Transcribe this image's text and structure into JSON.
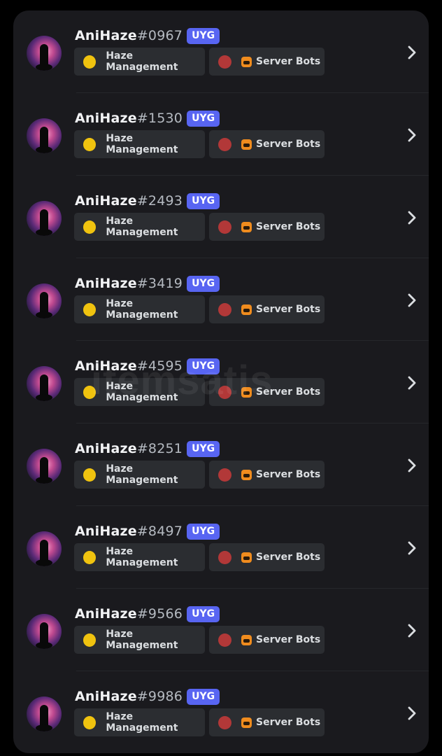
{
  "rows": [
    {
      "username": "AniHaze",
      "discriminator": "#0967",
      "badge": "UYG",
      "role1": "Haze Management",
      "role2": "Server Bots"
    },
    {
      "username": "AniHaze",
      "discriminator": "#1530",
      "badge": "UYG",
      "role1": "Haze Management",
      "role2": "Server Bots"
    },
    {
      "username": "AniHaze",
      "discriminator": "#2493",
      "badge": "UYG",
      "role1": "Haze Management",
      "role2": "Server Bots"
    },
    {
      "username": "AniHaze",
      "discriminator": "#3419",
      "badge": "UYG",
      "role1": "Haze Management",
      "role2": "Server Bots"
    },
    {
      "username": "AniHaze",
      "discriminator": "#4595",
      "badge": "UYG",
      "role1": "Haze Management",
      "role2": "Server Bots"
    },
    {
      "username": "AniHaze",
      "discriminator": "#8251",
      "badge": "UYG",
      "role1": "Haze Management",
      "role2": "Server Bots"
    },
    {
      "username": "AniHaze",
      "discriminator": "#8497",
      "badge": "UYG",
      "role1": "Haze Management",
      "role2": "Server Bots"
    },
    {
      "username": "AniHaze",
      "discriminator": "#9566",
      "badge": "UYG",
      "role1": "Haze Management",
      "role2": "Server Bots"
    },
    {
      "username": "AniHaze",
      "discriminator": "#9986",
      "badge": "UYG",
      "role1": "Haze Management",
      "role2": "Server Bots"
    }
  ],
  "watermark": "itemsatis",
  "colors": {
    "role1_dot": "#f0c30f",
    "role2_dot": "#b23838",
    "badge_bg": "#5865f2",
    "card_bg": "#1a1a1e",
    "chip_bg": "#2b2d31"
  },
  "icons": {
    "role2_emoji": "pumpkin-emoji-icon",
    "row_action": "chevron-right-icon"
  }
}
